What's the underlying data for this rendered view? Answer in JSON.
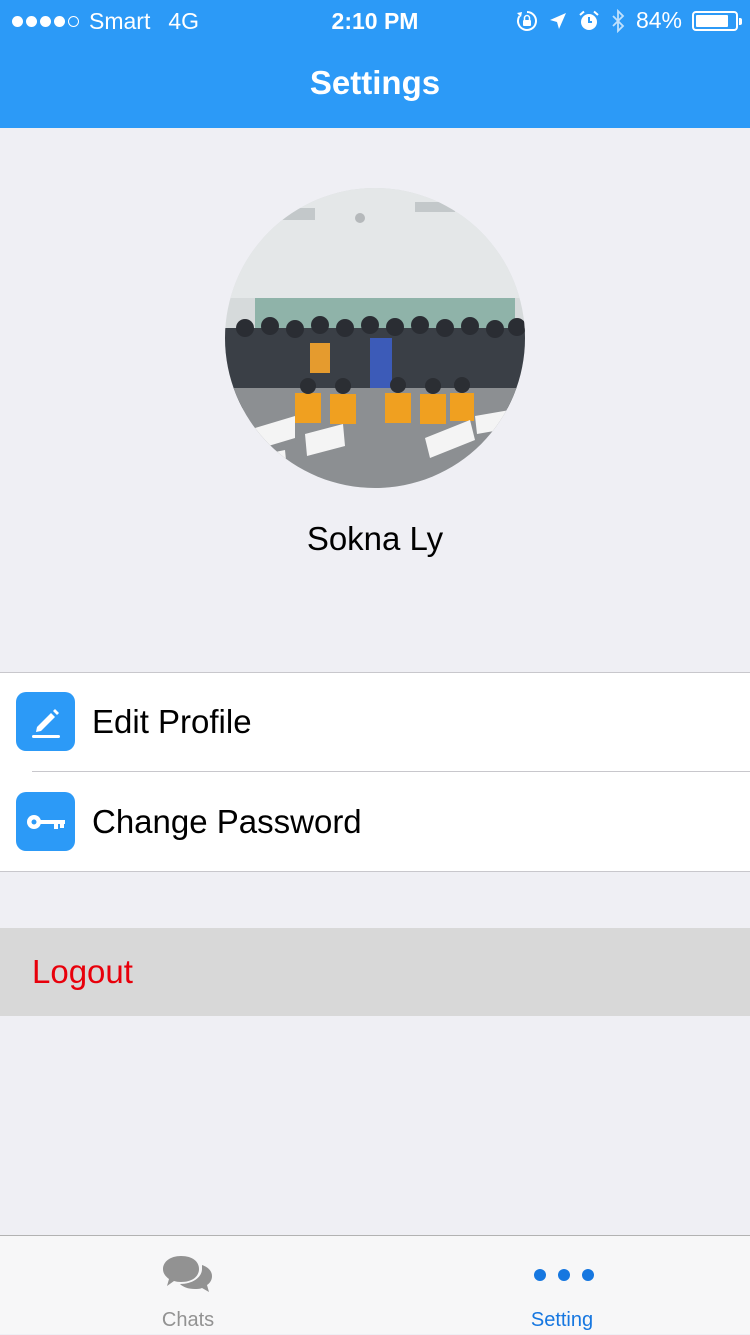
{
  "status_bar": {
    "carrier": "Smart",
    "network": "4G",
    "time": "2:10 PM",
    "battery_percent": "84%",
    "battery_level": 0.84,
    "signal_bars": 4,
    "icons": [
      "orientation-lock-icon",
      "location-arrow-icon",
      "alarm-icon",
      "bluetooth-icon",
      "battery-icon"
    ]
  },
  "nav": {
    "title": "Settings"
  },
  "profile": {
    "name": "Sokna Ly",
    "avatar": "group-photo-avatar"
  },
  "menu": {
    "items": [
      {
        "label": "Edit Profile",
        "icon": "edit-pencil-icon"
      },
      {
        "label": "Change Password",
        "icon": "key-icon"
      }
    ],
    "logout_label": "Logout"
  },
  "tabbar": {
    "tabs": [
      {
        "label": "Chats",
        "icon": "chat-bubbles-icon",
        "active": false
      },
      {
        "label": "Setting",
        "icon": "more-dots-icon",
        "active": true
      }
    ]
  },
  "colors": {
    "accent": "#2c9af7",
    "logout_text": "#e8000b",
    "active_tab": "#1677e0",
    "inactive_tab": "#929292",
    "background": "#efeff4"
  }
}
